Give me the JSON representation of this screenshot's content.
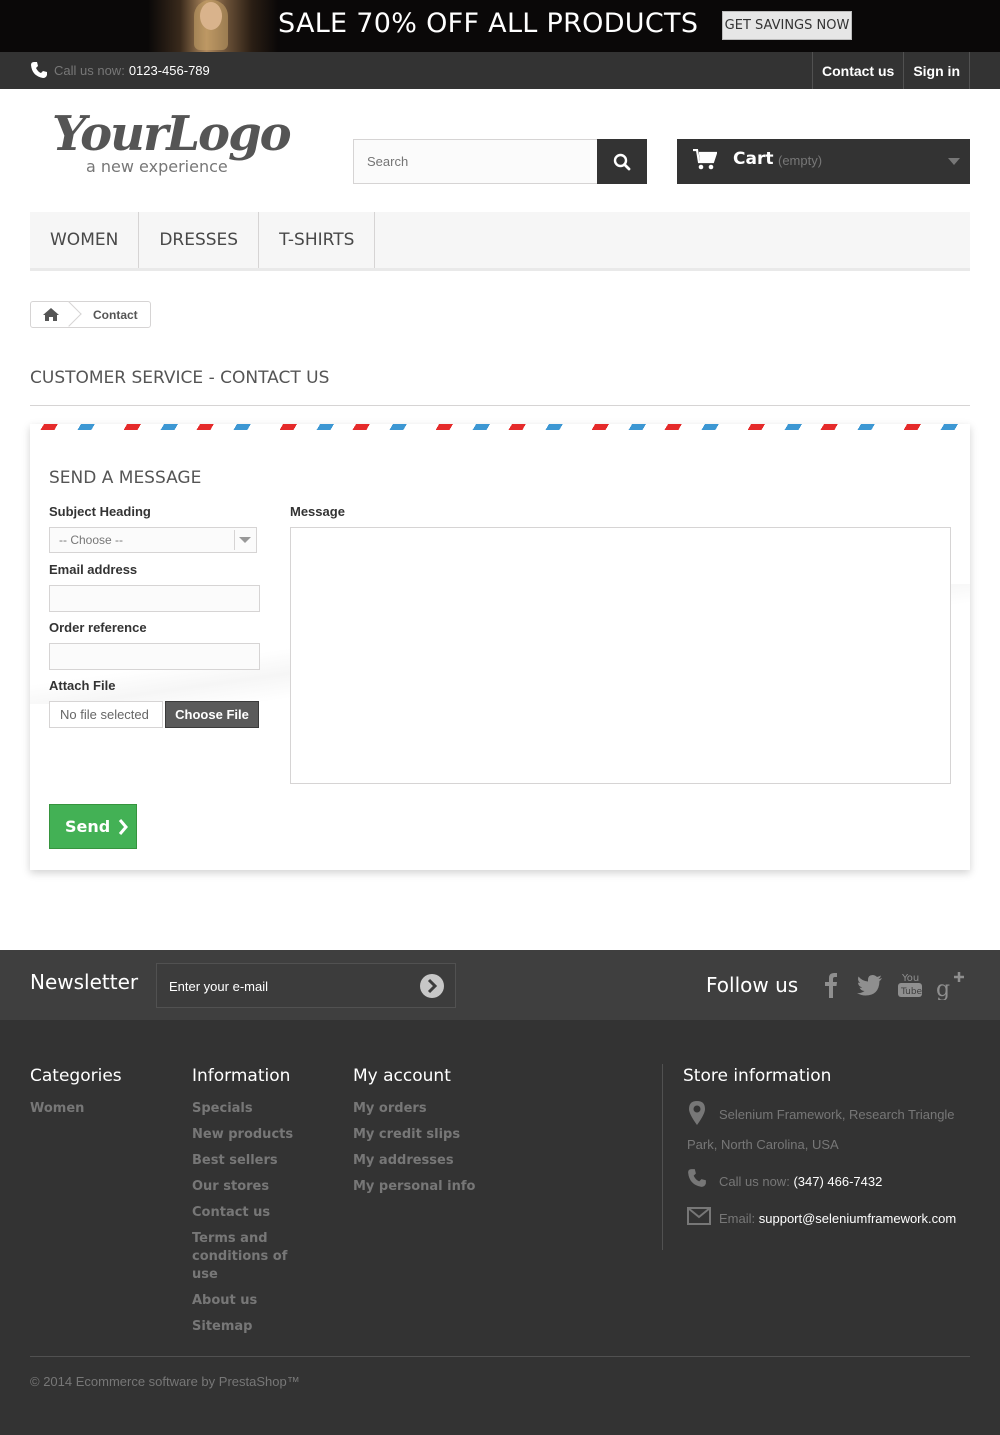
{
  "banner": {
    "text": "SALE 70% OFF ALL PRODUCTS",
    "button": "GET SAVINGS NOW"
  },
  "topnav": {
    "call_label": "Call us now:",
    "phone": "0123-456-789",
    "links": [
      "Contact us",
      "Sign in"
    ]
  },
  "header": {
    "logo_main": "YourLogo",
    "logo_sub": "a new experience",
    "search_placeholder": "Search",
    "cart_label": "Cart",
    "cart_status": "(empty)"
  },
  "menu": [
    "WOMEN",
    "DRESSES",
    "T-SHIRTS"
  ],
  "breadcrumb": {
    "current": "Contact"
  },
  "page_heading": "CUSTOMER SERVICE - CONTACT US",
  "form": {
    "title": "SEND A MESSAGE",
    "subject_label": "Subject Heading",
    "subject_value": "-- Choose --",
    "email_label": "Email address",
    "order_label": "Order reference",
    "attach_label": "Attach File",
    "file_status": "No file selected",
    "file_button": "Choose File",
    "message_label": "Message",
    "send_button": "Send"
  },
  "newsletter": {
    "title": "Newsletter",
    "placeholder": "Enter your e-mail",
    "follow_title": "Follow us"
  },
  "footer": {
    "categories": {
      "title": "Categories",
      "items": [
        "Women"
      ]
    },
    "information": {
      "title": "Information",
      "items": [
        "Specials",
        "New products",
        "Best sellers",
        "Our stores",
        "Contact us",
        "Terms and conditions of use",
        "About us",
        "Sitemap"
      ]
    },
    "account": {
      "title": "My account",
      "items": [
        "My orders",
        "My credit slips",
        "My addresses",
        "My personal info"
      ]
    },
    "store": {
      "title": "Store information",
      "address_line1": "Selenium Framework, Research Triangle",
      "address_line2": "Park, North Carolina, USA",
      "call_label": "Call us now:",
      "phone": "(347) 466-7432",
      "email_label": "Email:",
      "email": "support@seleniumframework.com"
    },
    "copyright": "© 2014 Ecommerce software by PrestaShop™"
  },
  "colors": {
    "accent_green": "#43b155",
    "dark": "#333333",
    "stripe_red": "#e52a2a",
    "stripe_blue": "#3c97d3"
  },
  "icons": [
    "phone-icon",
    "search-icon",
    "cart-icon",
    "home-icon",
    "chevron-right-icon",
    "arrow-circle-icon",
    "facebook-icon",
    "twitter-icon",
    "youtube-icon",
    "google-plus-icon",
    "map-pin-icon",
    "envelope-icon"
  ]
}
